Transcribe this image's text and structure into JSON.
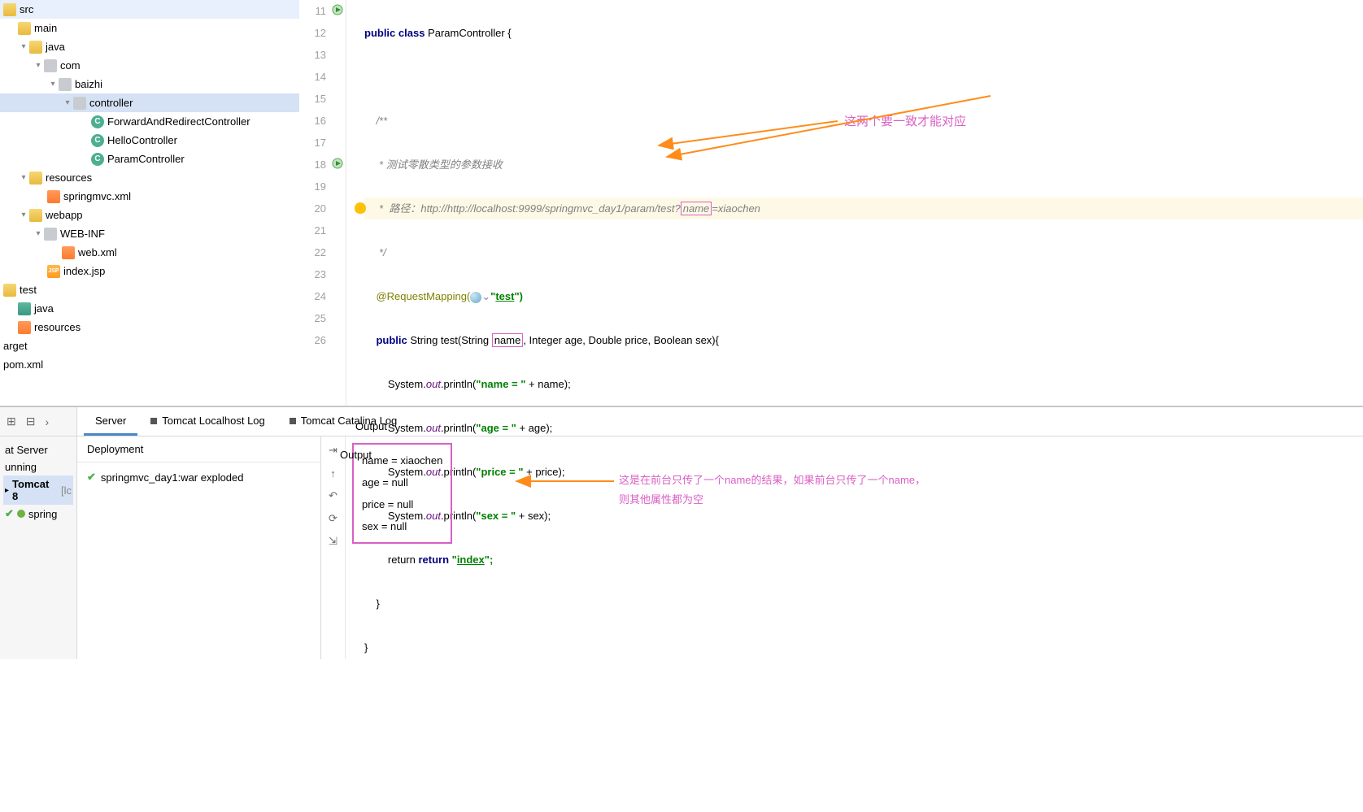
{
  "tree": {
    "src": "src",
    "main": "main",
    "java": "java",
    "com": "com",
    "baizhi": "baizhi",
    "controller": "controller",
    "c1": "ForwardAndRedirectController",
    "c2": "HelloController",
    "c3": "ParamController",
    "resources": "resources",
    "springxml": "springmvc.xml",
    "webapp": "webapp",
    "webinf": "WEB-INF",
    "webxml": "web.xml",
    "indexjsp": "index.jsp",
    "test": "test",
    "java2": "java",
    "res2": "resources",
    "target": "arget",
    "pom": "pom.xml"
  },
  "code": {
    "l11": "public class ParamController {",
    "l13": "    /**",
    "l14": "     * 测试零散类型的参数接收",
    "l15a": "     *  路径：http://http://localhost:9999/springmvc_day1/param/test?",
    "l15b": "name",
    "l15c": "=xiaochen",
    "l16": "     */",
    "l17a": "    @RequestMapping(",
    "l17b": "\"",
    "l17c": "test",
    "l17d": "\")",
    "l18a": "    public String test(String ",
    "l18b": "name",
    "l18c": ", Integer age, Double price, Boolean sex){",
    "l19a": "        System.",
    "l19b": "out",
    "l19c": ".println(",
    "l19d": "\"name = \"",
    "l19e": " + name);",
    "l20a": "        System.",
    "l20b": "out",
    "l20c": ".println(",
    "l20d": "\"age = \"",
    "l20e": " + age);",
    "l21a": "        System.",
    "l21b": "out",
    "l21c": ".println(",
    "l21d": "\"price = \"",
    "l21e": " + price);",
    "l22a": "        System.",
    "l22b": "out",
    "l22c": ".println(",
    "l22d": "\"sex = \"",
    "l22e": " + sex);",
    "l23a": "        return ",
    "l23b": "\"",
    "l23c": "index",
    "l23d": "\";",
    "l24": "    }",
    "l25": "}"
  },
  "lines": [
    "11",
    "12",
    "13",
    "14",
    "15",
    "16",
    "17",
    "18",
    "19",
    "20",
    "21",
    "22",
    "23",
    "24",
    "25",
    "26"
  ],
  "annotation1": "这两个要一致才能对应",
  "bottom": {
    "tabs": {
      "server": "Server",
      "log1": "Tomcat Localhost Log",
      "log2": "Tomcat Catalina Log"
    },
    "run": {
      "head1": "at Server",
      "head2": "unning",
      "tom": "Tomcat 8",
      "lc": "[lc",
      "spring": "spring"
    },
    "deploy": {
      "head": "Deployment",
      "item": "springmvc_day1:war exploded"
    },
    "output": {
      "head": "Output",
      "l1": "name = xiaochen",
      "l2": "age = null",
      "l3": "price = null",
      "l4": "sex = null"
    },
    "note_a": "这是在前台只传了一个name的结果，如果前台只传了一个name，",
    "note_b": "则其他属性都为空"
  }
}
